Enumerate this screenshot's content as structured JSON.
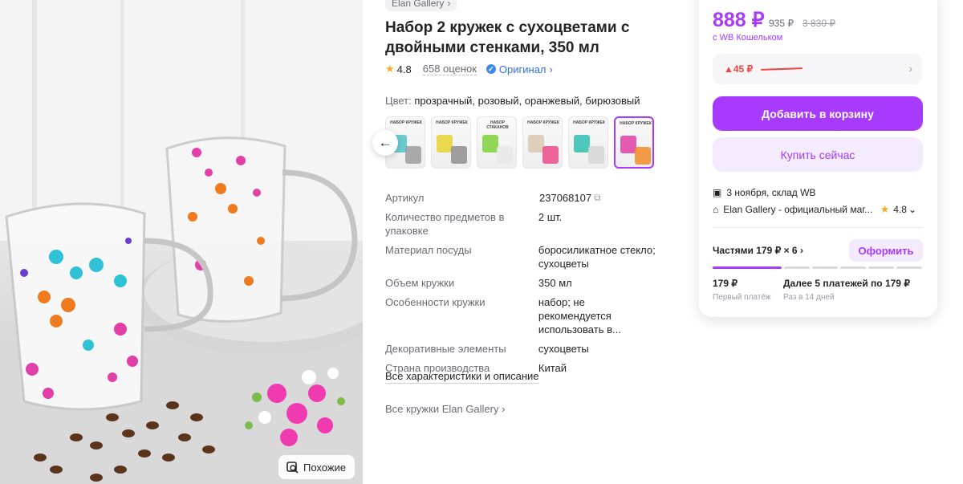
{
  "photo": {
    "similar_label": "Похожие"
  },
  "product": {
    "brand": "Elan Gallery",
    "title": "Набор 2 кружек с сухоцветами с двойными стенками, 350 мл",
    "rating": "4.8",
    "reviews": "658 оценок",
    "original_label": "Оригинал",
    "color_label": "Цвет:",
    "color_value": "прозрачный, розовый, оранжевый, бирюзовый"
  },
  "thumbs": [
    {
      "label": "НАБОР КРУЖЕК",
      "colors": [
        "#4fc3c7",
        "#9e9e9e"
      ]
    },
    {
      "label": "НАБОР КРУЖЕК",
      "colors": [
        "#e7d431",
        "#8f8f8f"
      ]
    },
    {
      "label": "НАБОР СТАКАНОВ",
      "colors": [
        "#7fd13b",
        "#e8e8e8"
      ]
    },
    {
      "label": "НАБОР КРУЖЕК",
      "colors": [
        "#d9c7b0",
        "#e94b8a"
      ]
    },
    {
      "label": "НАБОР КРУЖЕК",
      "colors": [
        "#2fbfb0",
        "#d6d6d6"
      ]
    },
    {
      "label": "НАБОР КРУЖЕК",
      "colors": [
        "#e23fa8",
        "#f28c28"
      ]
    }
  ],
  "specs": [
    {
      "k": "Артикул",
      "v": "237068107"
    },
    {
      "k": "Количество предметов в упаковке",
      "v": "2 шт."
    },
    {
      "k": "Материал посуды",
      "v": "боросиликатное стекло; сухоцветы"
    },
    {
      "k": "Объем кружки",
      "v": "350 мл"
    },
    {
      "k": "Особенности кружки",
      "v": "набор; не рекомендуется использовать в..."
    },
    {
      "k": "Декоративные элементы",
      "v": "сухоцветы"
    },
    {
      "k": "Страна производства",
      "v": "Китай"
    }
  ],
  "links": {
    "all_chars": "Все характеристики и описание",
    "all_brand": "Все кружки Elan Gallery"
  },
  "price": {
    "main": "888 ₽",
    "old": "935 ₽",
    "strike": "3 830 ₽",
    "wallet_note": "с WB Кошельком",
    "drop": "▲45 ₽"
  },
  "buttons": {
    "add_to_cart": "Добавить в корзину",
    "buy_now": "Купить сейчас",
    "checkout": "Оформить"
  },
  "delivery": {
    "date": "3 ноября, склад WB",
    "seller": "Elan Gallery - официальный маг...",
    "seller_rating": "4.8"
  },
  "installments": {
    "label": "Частями 179 ₽ × 6",
    "segments": 6,
    "first_amount": "179 ₽",
    "first_sub": "Первый платёж",
    "rest": "Далее 5 платежей по 179 ₽",
    "rest_sub": "Раз в 14 дней"
  },
  "colors": {
    "accent": "#a73afd",
    "accent_light": "#f5ebff",
    "drop_red": "#f0443c",
    "link_blue": "#3170d8"
  }
}
